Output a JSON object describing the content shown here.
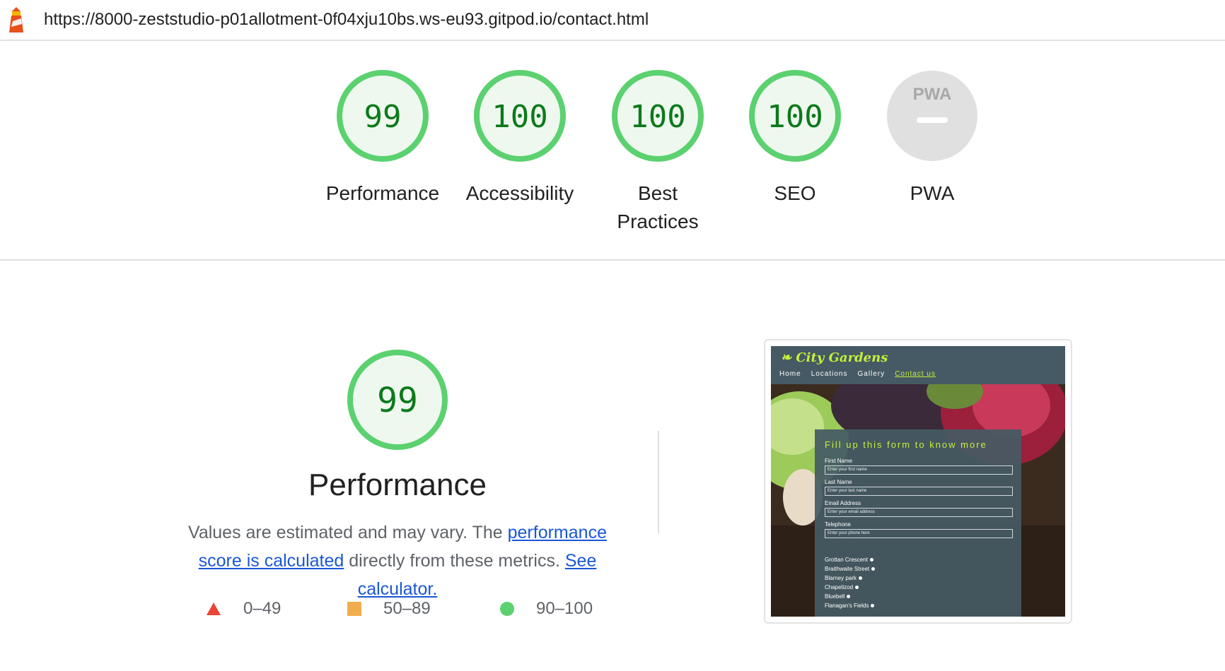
{
  "url_bar": {
    "url": "https://8000-zeststudio-p01allotment-0f04xju10bs.ws-eu93.gitpod.io/contact.html"
  },
  "scores": [
    {
      "label": "Performance",
      "score": "99",
      "value": 99
    },
    {
      "label": "Accessibility",
      "score": "100",
      "value": 100
    },
    {
      "label": "Best Practices",
      "score": "100",
      "value": 100
    },
    {
      "label": "SEO",
      "score": "100",
      "value": 100
    },
    {
      "label": "PWA",
      "badge_text": "PWA"
    }
  ],
  "performance": {
    "score": "99",
    "value": 99,
    "title": "Performance",
    "desc_prefix": "Values are estimated and may vary. The ",
    "link_score": "performance score is calculated",
    "desc_middle": " directly from these metrics. ",
    "link_calc": "See calculator."
  },
  "legend": [
    {
      "label": "0–49",
      "color": "#eb4335",
      "shape": "triangle"
    },
    {
      "label": "50–89",
      "color": "#f0ad4e",
      "shape": "square"
    },
    {
      "label": "90–100",
      "color": "#5bd16f",
      "shape": "circle"
    }
  ],
  "thumbnail": {
    "brand": "City Gardens",
    "nav": [
      "Home",
      "Locations",
      "Gallery",
      "Contact us"
    ],
    "form_heading": "Fill up this form to know more",
    "fields": [
      {
        "label": "First Name",
        "placeholder": "Enter your first name"
      },
      {
        "label": "Last Name",
        "placeholder": "Enter your last name"
      },
      {
        "label": "Email Address",
        "placeholder": "Enter your email address"
      },
      {
        "label": "Telephone",
        "placeholder": "Enter your phone here"
      }
    ],
    "locations": [
      "Grottan Crescent",
      "Braithwaite Street",
      "Blarney park",
      "Chapelizod",
      "Bluebell",
      "Flanagan's Fields"
    ]
  },
  "colors": {
    "pass_green": "#0c7a1a",
    "ring_green": "#5bd16f",
    "fill_green": "#eef8ef",
    "pwa_gray": "#e0e0e0",
    "link_blue": "#1a57d6",
    "lime": "#c6ef3a"
  },
  "icons": {
    "logo": "lighthouse-icon"
  }
}
